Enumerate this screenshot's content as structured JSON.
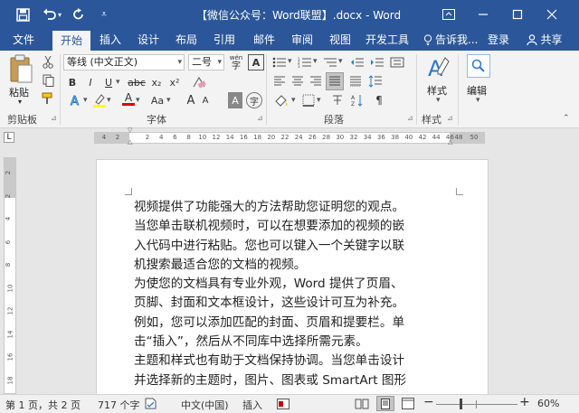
{
  "titlebar": {
    "title": "【微信公众号：Word联盟】.docx - Word",
    "save_icon": "save-icon",
    "undo_icon": "undo-icon",
    "redo_icon": "redo-icon",
    "customize_icon": "customize-qat-icon"
  },
  "tabs": [
    {
      "label": "文件"
    },
    {
      "label": "开始"
    },
    {
      "label": "插入"
    },
    {
      "label": "设计"
    },
    {
      "label": "布局"
    },
    {
      "label": "引用"
    },
    {
      "label": "邮件"
    },
    {
      "label": "审阅"
    },
    {
      "label": "视图"
    },
    {
      "label": "开发工具"
    }
  ],
  "tellme": {
    "label": "告诉我..."
  },
  "account": {
    "login": "登录",
    "share": "共享"
  },
  "ribbon": {
    "clipboard": {
      "paste": "粘贴",
      "label": "剪贴板"
    },
    "font": {
      "name": "等线 (中文正文)",
      "size": "二号",
      "label": "字体",
      "bold": "B",
      "italic": "I",
      "underline": "U",
      "strike": "abc",
      "subscript": "x₂",
      "superscript": "x²",
      "font_color": "A",
      "case": "Aa",
      "grow": "A",
      "shrink": "A",
      "phonetic": "wén",
      "border_char": "A",
      "shading_char": "A",
      "enclosed": "字"
    },
    "paragraph": {
      "label": "段落"
    },
    "styles": {
      "label": "样式",
      "button": "样式"
    },
    "editing": {
      "button": "编辑"
    }
  },
  "ruler": {
    "left_ticks": [
      "4",
      "2"
    ],
    "ticks": [
      "2",
      "4",
      "6",
      "8",
      "10",
      "12",
      "14",
      "16",
      "18",
      "20",
      "22",
      "24",
      "26",
      "28",
      "30",
      "32",
      "34",
      "36",
      "38",
      "40",
      "42",
      "44",
      "46"
    ],
    "right_ticks": [
      "48",
      "50"
    ],
    "vticks": [
      "2",
      "2",
      "4",
      "6",
      "8",
      "10",
      "12",
      "14",
      "16",
      "18"
    ]
  },
  "document": {
    "lines": [
      "视频提供了功能强大的方法帮助您证明您的观点。",
      "当您单击联机视频时，可以在想要添加的视频的嵌",
      "入代码中进行粘贴。您也可以键入一个关键字以联",
      "机搜索最适合您的文档的视频。",
      "为使您的文档具有专业外观，Word 提供了页眉、",
      "页脚、封面和文本框设计，这些设计可互为补充。",
      "例如，您可以添加匹配的封面、页眉和提要栏。单",
      "击“插入”，然后从不同库中选择所需元素。",
      "主题和样式也有助于文档保持协调。当您单击设计",
      "并选择新的主题时，图片、图表或 SmartArt 图形"
    ]
  },
  "status": {
    "page": "第 1 页，共 2 页",
    "words": "717 个字",
    "language": "中文(中国)",
    "mode": "插入",
    "zoom": "60%"
  },
  "colors": {
    "accent": "#2b579a",
    "highlight": "#ffff00",
    "font_color": "#e00000"
  }
}
